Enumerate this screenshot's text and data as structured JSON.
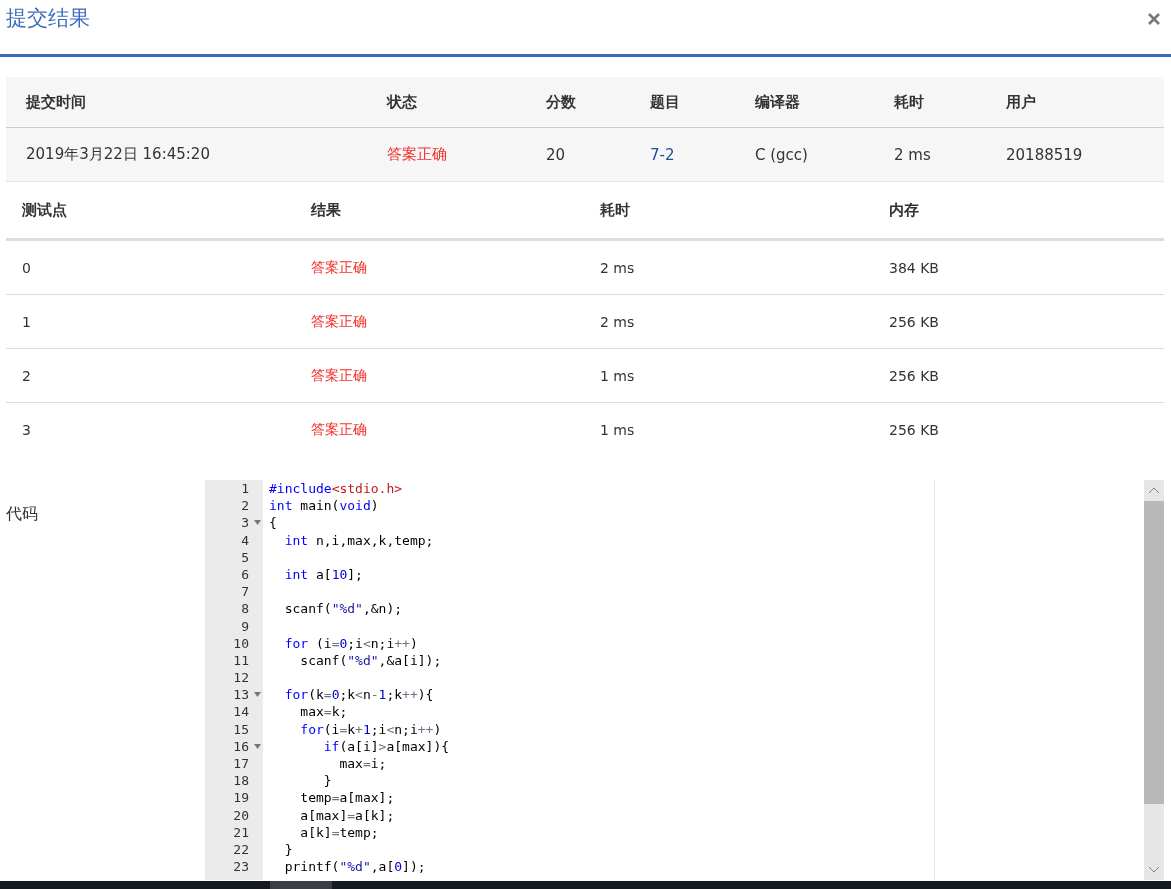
{
  "dialog": {
    "title": "提交结果"
  },
  "summary": {
    "columns": [
      "提交时间",
      "状态",
      "分数",
      "题目",
      "编译器",
      "耗时",
      "用户"
    ],
    "row": {
      "time": "2019年3月22日 16:45:20",
      "status": "答案正确",
      "score": "20",
      "problem": "7-2",
      "compiler": "C (gcc)",
      "duration": "2 ms",
      "user": "20188519"
    }
  },
  "tests": {
    "columns": [
      "测试点",
      "结果",
      "耗时",
      "内存"
    ],
    "rows": [
      {
        "case": "0",
        "result": "答案正确",
        "time": "2 ms",
        "memory": "384 KB"
      },
      {
        "case": "1",
        "result": "答案正确",
        "time": "2 ms",
        "memory": "256 KB"
      },
      {
        "case": "2",
        "result": "答案正确",
        "time": "1 ms",
        "memory": "256 KB"
      },
      {
        "case": "3",
        "result": "答案正确",
        "time": "1 ms",
        "memory": "256 KB"
      }
    ]
  },
  "code": {
    "label": "代码",
    "lines": [
      {
        "number": "1",
        "fold": false,
        "tokens": [
          {
            "kind": "keyword",
            "text": "#include"
          },
          {
            "kind": "header",
            "text": "<stdio.h>"
          }
        ]
      },
      {
        "number": "2",
        "fold": false,
        "tokens": [
          {
            "kind": "keyword",
            "text": "int"
          },
          {
            "kind": "plain",
            "text": " main("
          },
          {
            "kind": "keyword",
            "text": "void"
          },
          {
            "kind": "plain",
            "text": ")"
          }
        ]
      },
      {
        "number": "3",
        "fold": true,
        "tokens": [
          {
            "kind": "plain",
            "text": "{"
          }
        ]
      },
      {
        "number": "4",
        "fold": false,
        "tokens": [
          {
            "kind": "keyword",
            "text": "  int"
          },
          {
            "kind": "plain",
            "text": " n,i,max,k,temp;"
          }
        ]
      },
      {
        "number": "5",
        "fold": false
      },
      {
        "number": "6",
        "fold": false,
        "tokens": [
          {
            "kind": "keyword",
            "text": "  int"
          },
          {
            "kind": "plain",
            "text": " a["
          },
          {
            "kind": "number",
            "text": "10"
          },
          {
            "kind": "plain",
            "text": "];"
          }
        ]
      },
      {
        "number": "7",
        "fold": false
      },
      {
        "number": "8",
        "fold": false,
        "tokens": [
          {
            "kind": "plain",
            "text": "  scanf("
          },
          {
            "kind": "string",
            "text": "\"%d\""
          },
          {
            "kind": "plain",
            "text": ",&n);"
          }
        ]
      },
      {
        "number": "9",
        "fold": false
      },
      {
        "number": "10",
        "fold": false,
        "tokens": [
          {
            "kind": "keyword",
            "text": "  for"
          },
          {
            "kind": "plain",
            "text": " (i"
          },
          {
            "kind": "operator",
            "text": "="
          },
          {
            "kind": "number",
            "text": "0"
          },
          {
            "kind": "plain",
            "text": ";i"
          },
          {
            "kind": "operator",
            "text": "<"
          },
          {
            "kind": "plain",
            "text": "n;i"
          },
          {
            "kind": "operator",
            "text": "++"
          },
          {
            "kind": "plain",
            "text": ")"
          }
        ]
      },
      {
        "number": "11",
        "fold": false,
        "tokens": [
          {
            "kind": "plain",
            "text": "    scanf("
          },
          {
            "kind": "string",
            "text": "\"%d\""
          },
          {
            "kind": "plain",
            "text": ",&a[i]);"
          }
        ]
      },
      {
        "number": "12",
        "fold": false
      },
      {
        "number": "13",
        "fold": true,
        "tokens": [
          {
            "kind": "keyword",
            "text": "  for"
          },
          {
            "kind": "plain",
            "text": "(k"
          },
          {
            "kind": "operator",
            "text": "="
          },
          {
            "kind": "number",
            "text": "0"
          },
          {
            "kind": "plain",
            "text": ";k"
          },
          {
            "kind": "operator",
            "text": "<"
          },
          {
            "kind": "plain",
            "text": "n"
          },
          {
            "kind": "operator",
            "text": "-"
          },
          {
            "kind": "number",
            "text": "1"
          },
          {
            "kind": "plain",
            "text": ";k"
          },
          {
            "kind": "operator",
            "text": "++"
          },
          {
            "kind": "plain",
            "text": "){"
          }
        ]
      },
      {
        "number": "14",
        "fold": false,
        "tokens": [
          {
            "kind": "plain",
            "text": "    max"
          },
          {
            "kind": "operator",
            "text": "="
          },
          {
            "kind": "plain",
            "text": "k;"
          }
        ]
      },
      {
        "number": "15",
        "fold": false,
        "tokens": [
          {
            "kind": "keyword",
            "text": "    for"
          },
          {
            "kind": "plain",
            "text": "(i"
          },
          {
            "kind": "operator",
            "text": "="
          },
          {
            "kind": "plain",
            "text": "k"
          },
          {
            "kind": "operator",
            "text": "+"
          },
          {
            "kind": "number",
            "text": "1"
          },
          {
            "kind": "plain",
            "text": ";i"
          },
          {
            "kind": "operator",
            "text": "<"
          },
          {
            "kind": "plain",
            "text": "n;i"
          },
          {
            "kind": "operator",
            "text": "++"
          },
          {
            "kind": "plain",
            "text": ")"
          }
        ]
      },
      {
        "number": "16",
        "fold": true,
        "tokens": [
          {
            "kind": "keyword",
            "text": "       if"
          },
          {
            "kind": "plain",
            "text": "(a[i]"
          },
          {
            "kind": "operator",
            "text": ">"
          },
          {
            "kind": "plain",
            "text": "a[max]){"
          }
        ]
      },
      {
        "number": "17",
        "fold": false,
        "tokens": [
          {
            "kind": "plain",
            "text": "         max"
          },
          {
            "kind": "operator",
            "text": "="
          },
          {
            "kind": "plain",
            "text": "i;"
          }
        ]
      },
      {
        "number": "18",
        "fold": false,
        "tokens": [
          {
            "kind": "plain",
            "text": "       }"
          }
        ]
      },
      {
        "number": "19",
        "fold": false,
        "tokens": [
          {
            "kind": "plain",
            "text": "    temp"
          },
          {
            "kind": "operator",
            "text": "="
          },
          {
            "kind": "plain",
            "text": "a[max];"
          }
        ]
      },
      {
        "number": "20",
        "fold": false,
        "tokens": [
          {
            "kind": "plain",
            "text": "    a[max]"
          },
          {
            "kind": "operator",
            "text": "="
          },
          {
            "kind": "plain",
            "text": "a[k];"
          }
        ]
      },
      {
        "number": "21",
        "fold": false,
        "tokens": [
          {
            "kind": "plain",
            "text": "    a[k]"
          },
          {
            "kind": "operator",
            "text": "="
          },
          {
            "kind": "plain",
            "text": "temp;"
          }
        ]
      },
      {
        "number": "22",
        "fold": false,
        "tokens": [
          {
            "kind": "plain",
            "text": "  }"
          }
        ]
      },
      {
        "number": "23",
        "fold": false,
        "tokens": [
          {
            "kind": "plain",
            "text": "  printf("
          },
          {
            "kind": "string",
            "text": "\"%d\""
          },
          {
            "kind": "plain",
            "text": ",a["
          },
          {
            "kind": "number",
            "text": "0"
          },
          {
            "kind": "plain",
            "text": "]);"
          }
        ]
      }
    ]
  }
}
